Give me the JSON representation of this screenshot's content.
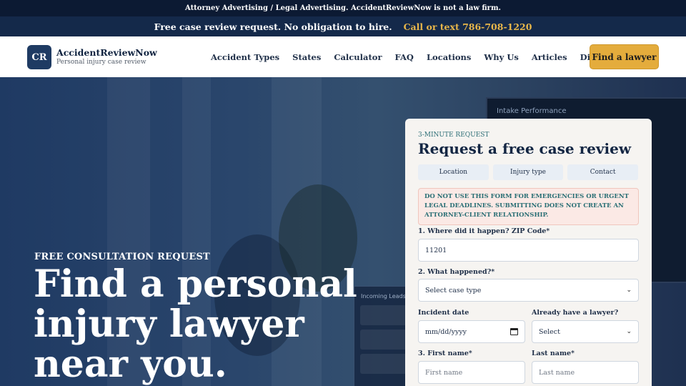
{
  "disclaimer_bar": {
    "text": "Attorney Advertising / Legal Advertising. AccidentReviewNow is not a law firm."
  },
  "promo_bar": {
    "text": "Free case review request. No obligation to hire.",
    "cta": "Call or text 786-708-1220"
  },
  "header": {
    "logo_initials": "CR",
    "brand_name": "AccidentReviewNow",
    "tagline": "Personal injury case review",
    "nav": [
      "Accident Types",
      "States",
      "Calculator",
      "FAQ",
      "Locations",
      "Why Us",
      "Articles",
      "Disclaimer"
    ],
    "cta_label": "Find a lawyer"
  },
  "hero": {
    "eyebrow": "FREE CONSULTATION REQUEST",
    "title": "Find a personal injury lawyer near you.",
    "background_monitor_title": "Intake Performance",
    "background_screen_title": "Incoming Leads"
  },
  "form": {
    "kicker": "3-MINUTE REQUEST",
    "title": "Request a free case review",
    "steps": [
      "Location",
      "Injury type",
      "Contact"
    ],
    "warning": "DO NOT USE THIS FORM FOR EMERGENCIES OR URGENT LEGAL DEADLINES. SUBMITTING DOES NOT CREATE AN ATTORNEY-CLIENT RELATIONSHIP.",
    "zip_label": "1. Where did it happen? ZIP Code*",
    "zip_value": "11201",
    "what_label": "2. What happened?*",
    "what_value": "Select case type",
    "date_label": "Incident date",
    "date_value": "mm/dd/yyyy",
    "lawyer_label": "Already have a lawyer?",
    "lawyer_value": "Select",
    "first_label": "3. First name*",
    "first_placeholder": "First name",
    "last_label": "Last name*",
    "last_placeholder": "Last name"
  },
  "colors": {
    "navy": "#14294a",
    "accent": "#e4ac3c",
    "teal": "#2a6f75"
  }
}
